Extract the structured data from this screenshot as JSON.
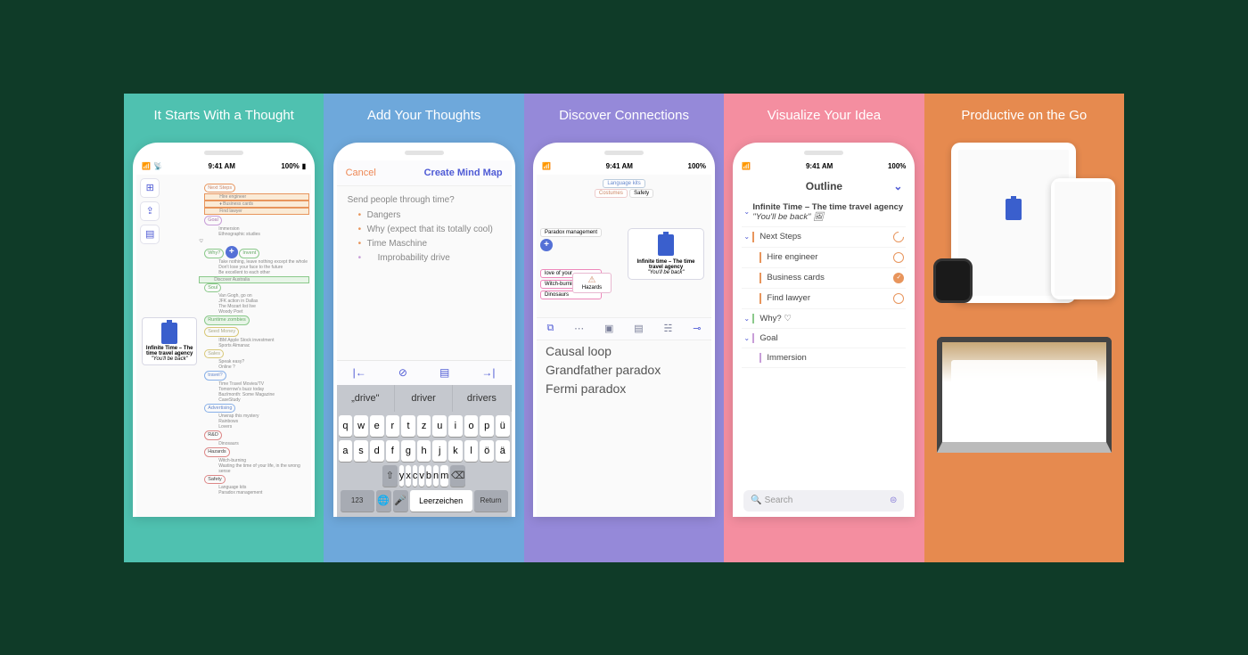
{
  "panels": {
    "titles": [
      "It Starts With a Thought",
      "Add Your Thoughts",
      "Discover Connections",
      "Visualize Your Idea",
      "Productive on the Go"
    ]
  },
  "statusbar": {
    "time": "9:41 AM",
    "battery": "100%"
  },
  "panel1": {
    "root_title": "Infinite Time – The time travel agency",
    "root_sub": "\"You'll be back\"",
    "b_nextsteps": "Next Steps",
    "b_hire": "Hire engineer",
    "b_bizcards": "♦ Business cards",
    "b_lawyer": "Find lawyer",
    "b_goal": "Goal",
    "b_immersion": "Immersion",
    "b_ethno": "Ethnographic studies",
    "b_why": "Why?",
    "b_invent": "Invent",
    "b_take_nothing": "Take nothing, leave nothing except the whole",
    "b_dont_lose": "Don't lose your face to the future",
    "b_excellent": "Be excellent to each other",
    "b_discover": "Discover Australia",
    "b_soul": "Soul",
    "b_vanggogh": "Van Gogh, go on",
    "b_jfk": "JFK action in Dallas",
    "b_mozart": "The Mozart list live",
    "b_woody": "Woody Poet",
    "b_runtime": "Runtime zombies",
    "b_seedmoney": "Seed Money",
    "b_ibmapple": "IBM Apple Stock investment",
    "b_sports": "Sports Almanac",
    "b_sales": "Sales",
    "b_speakeasy": "Speak easy?",
    "b_online": "Online ?",
    "b_travel": "travel?",
    "b_timetravel": "Time Travel Movies/TV",
    "b_tomorrow": "Tomorrow's buzz today",
    "b_baz": "Baz/month: Some Magazine",
    "b_casestudy": "CaseStudy",
    "b_advertising": "Advertising",
    "b_unwrap": "Unwrap this mystery",
    "b_rainbow": "Rainbows",
    "b_lovers": "Lovers",
    "b_rnd": "R&D",
    "b_dinosaurs": "Dinosaurs",
    "b_hazards": "Hazards",
    "b_witch": "Witch-burning",
    "b_wasting": "Wasting the time of your life, in the wrong sense",
    "b_safety": "Safety",
    "b_language": "Language kits",
    "b_paradox": "Paradox management"
  },
  "panel2": {
    "cancel": "Cancel",
    "create": "Create Mind Map",
    "question": "Send people through time?",
    "items": [
      "Dangers",
      "Why (expect that its totally cool)",
      "Time Maschine",
      "Improbability drive"
    ],
    "suggestions": [
      "„drive\"",
      "driver",
      "drivers"
    ],
    "keys_r1": [
      "q",
      "w",
      "e",
      "r",
      "t",
      "z",
      "u",
      "i",
      "o",
      "p",
      "ü"
    ],
    "keys_r2": [
      "a",
      "s",
      "d",
      "f",
      "g",
      "h",
      "j",
      "k",
      "l",
      "ö",
      "ä"
    ],
    "keys_r3": [
      "y",
      "x",
      "c",
      "v",
      "b",
      "n",
      "m"
    ],
    "key_123": "123",
    "key_space": "Leerzeichen",
    "key_return": "Return"
  },
  "panel3": {
    "tag_lang": "Language kits",
    "tag_costumes": "Costumes",
    "tag_safety": "Safety",
    "tag_paradox": "Paradox management",
    "tag_loveyour": "love of your",
    "tag_witch": "Witch-burning",
    "tag_dino": "Dinosaurs",
    "hazard_label": "Hazards",
    "card_title": "Infinite time – The time travel agency",
    "card_sub": "\"You'll be back\"",
    "list": [
      "Causal loop",
      "Grandfather paradox",
      "Fermi paradox"
    ]
  },
  "panel4": {
    "header": "Outline",
    "root": "Infinite Time – The time travel agency",
    "root_sub": "\"You'll be back\" 🖼",
    "rows": [
      {
        "txt": "Next Steps",
        "lvl": 0,
        "c": "#e8955c",
        "status": "partial"
      },
      {
        "txt": "Hire engineer",
        "lvl": 1,
        "c": "#e8955c",
        "status": "empty"
      },
      {
        "txt": "Business cards",
        "lvl": 1,
        "c": "#e8955c",
        "status": "done"
      },
      {
        "txt": "Find lawyer",
        "lvl": 1,
        "c": "#e8955c",
        "status": "empty"
      },
      {
        "txt": "Why? ♡",
        "lvl": 0,
        "c": "#8bc98b",
        "status": ""
      },
      {
        "txt": "Goal",
        "lvl": 0,
        "c": "#c89ed8",
        "status": ""
      },
      {
        "txt": "Immersion",
        "lvl": 1,
        "c": "#c89ed8",
        "status": ""
      }
    ],
    "search_ph": "Search"
  }
}
